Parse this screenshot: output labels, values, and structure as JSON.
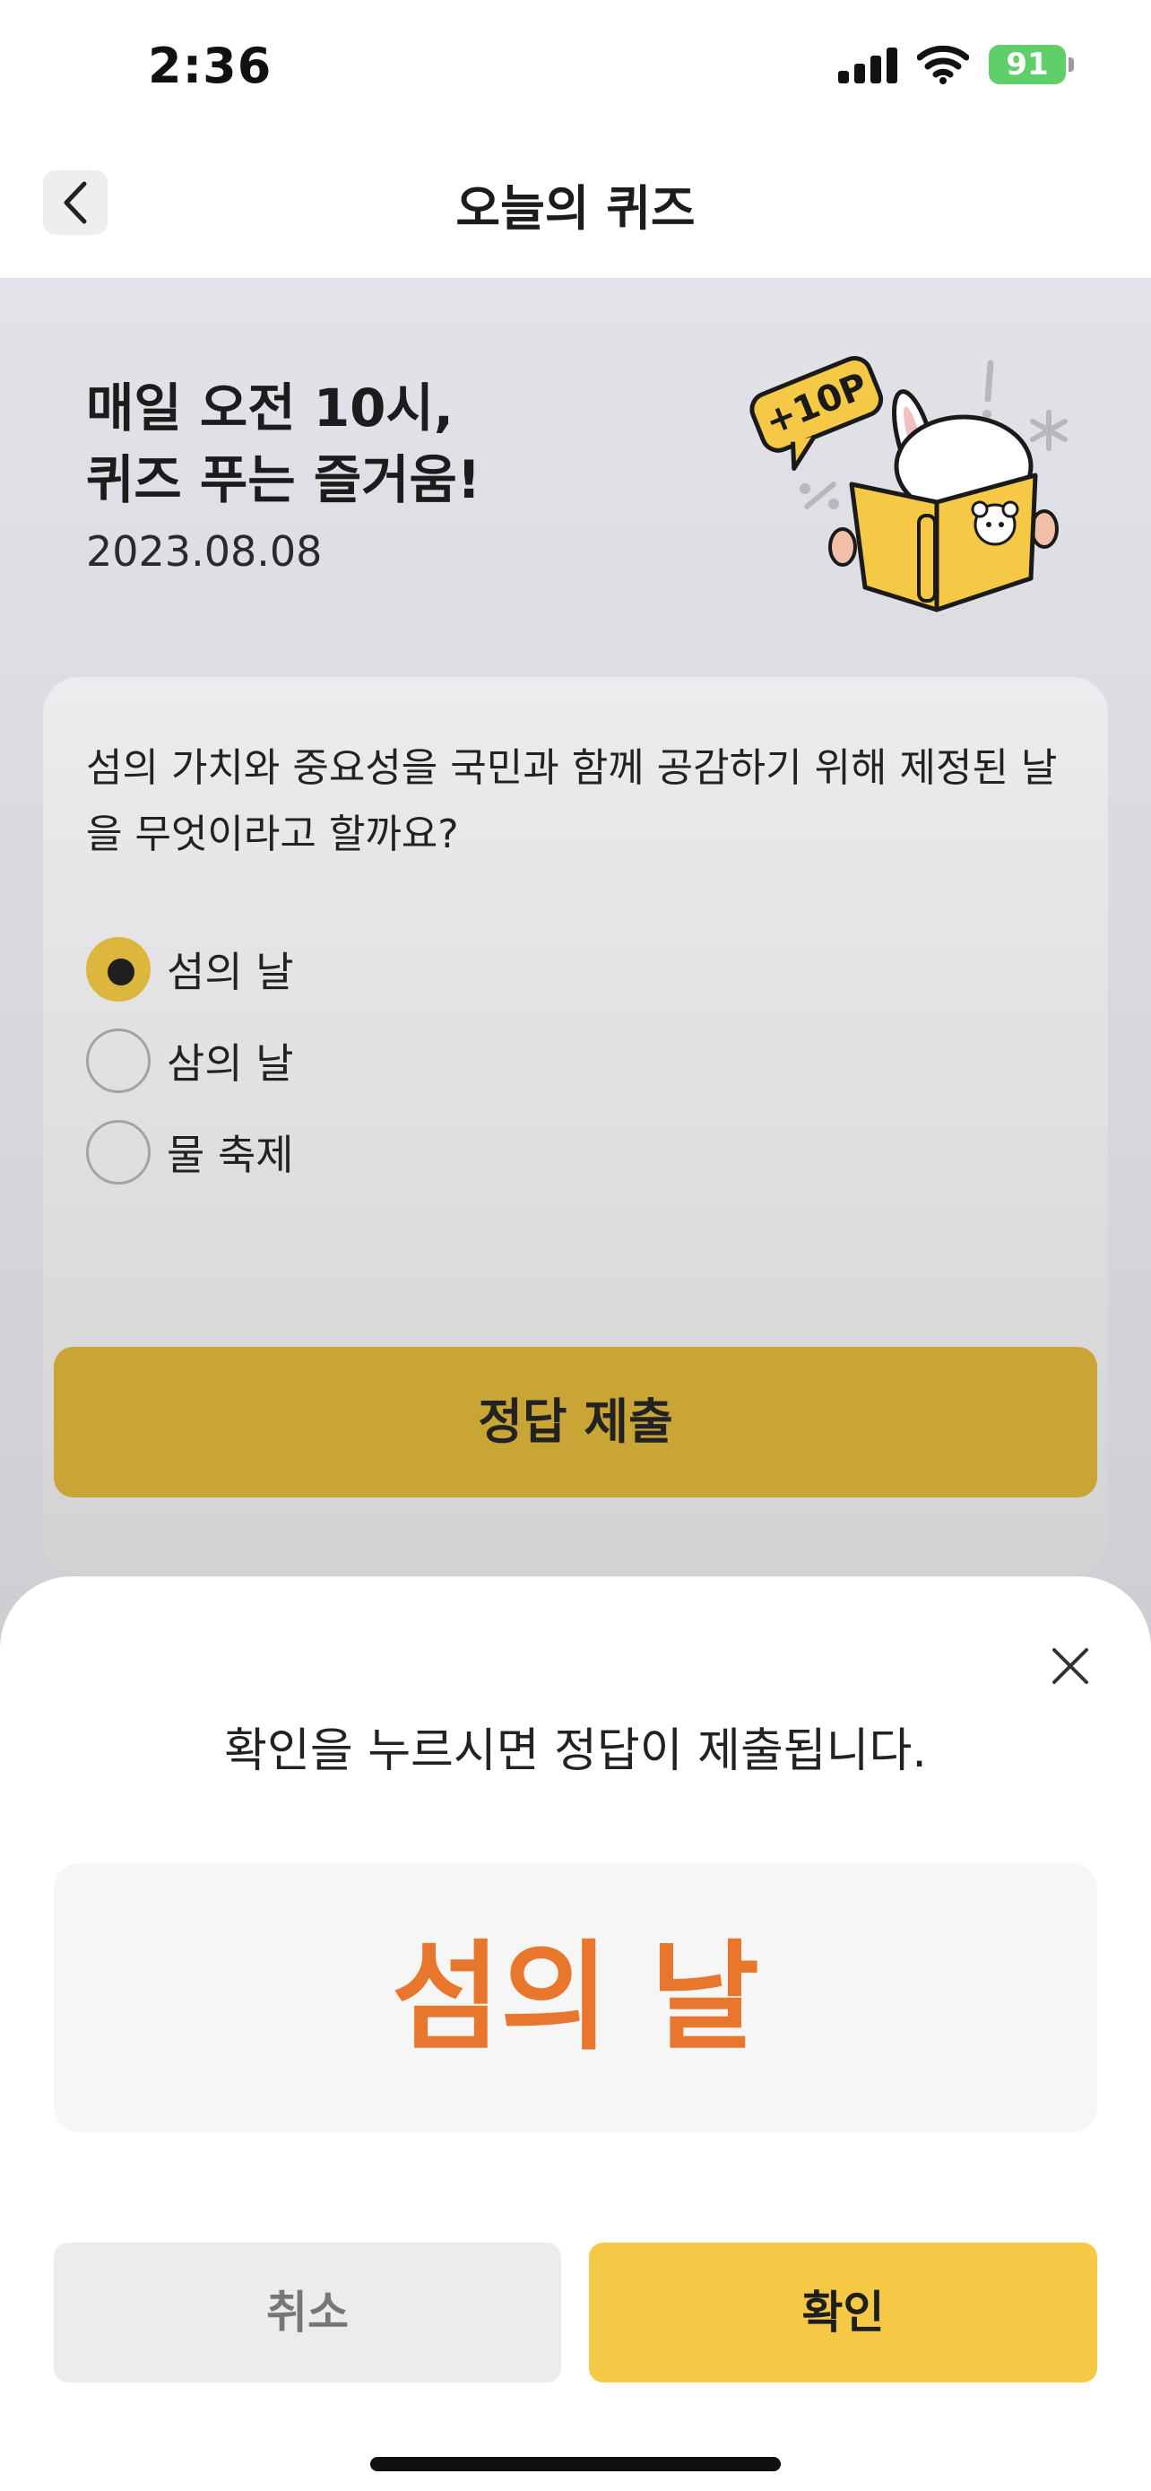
{
  "status_bar": {
    "time": "2:36",
    "battery": "91"
  },
  "nav": {
    "title": "오늘의 퀴즈"
  },
  "hero": {
    "line1": "매일 오전 10시,",
    "line2": "퀴즈 푸는 즐거움!",
    "date": "2023.08.08",
    "badge": "+10P"
  },
  "quiz": {
    "question": "섬의 가치와 중요성을 국민과 함께 공감하기 위해 제정된 날을 무엇이라고 할까요?",
    "options": [
      {
        "label": "섬의 날",
        "selected": true
      },
      {
        "label": "삼의 날",
        "selected": false
      },
      {
        "label": "물 축제",
        "selected": false
      }
    ],
    "submit_label": "정답 제출"
  },
  "sheet": {
    "message": "확인을 누르시면 정답이 제출됩니다.",
    "selected_answer": "섬의 날",
    "cancel_label": "취소",
    "confirm_label": "확인"
  },
  "colors": {
    "accent_yellow": "#f5c945",
    "answer_orange": "#e8762d",
    "radio_selected": "#dcb63d",
    "battery_green": "#5fcf6a"
  }
}
